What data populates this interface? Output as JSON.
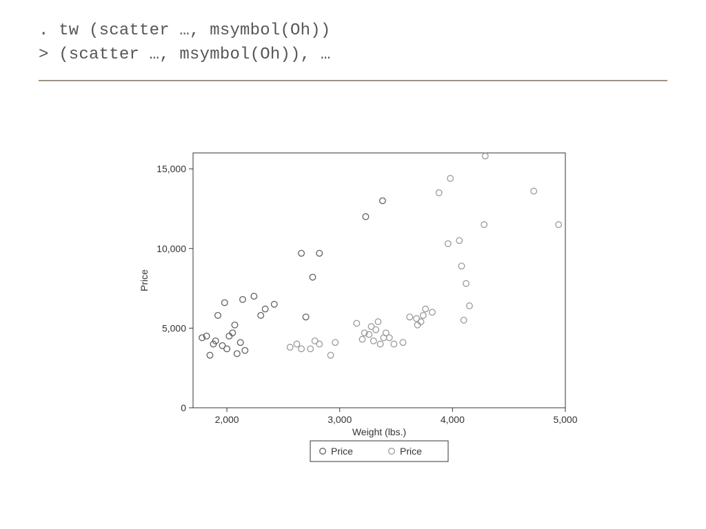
{
  "code": {
    "line1": ". tw (scatter …, msymbol(Oh))",
    "line2": "> (scatter …, msymbol(Oh)), …"
  },
  "chart_data": {
    "type": "scatter",
    "xlabel": "Weight (lbs.)",
    "ylabel": "Price",
    "xlim": [
      1700,
      5000
    ],
    "ylim": [
      0,
      16000
    ],
    "x_ticks": [
      2000,
      3000,
      4000,
      5000
    ],
    "y_ticks": [
      0,
      5000,
      10000,
      15000
    ],
    "x_tick_labels": [
      "2,000",
      "3,000",
      "4,000",
      "5,000"
    ],
    "y_tick_labels": [
      "0",
      "5,000",
      "10,000",
      "15,000"
    ],
    "legend": [
      {
        "label": "Price",
        "color": "#606060"
      },
      {
        "label": "Price",
        "color": "#9a9a9a"
      }
    ],
    "series": [
      {
        "name": "Price",
        "color": "#606060",
        "points": [
          [
            1780,
            4400
          ],
          [
            1820,
            4500
          ],
          [
            1850,
            3300
          ],
          [
            1880,
            4000
          ],
          [
            1900,
            4200
          ],
          [
            1920,
            5800
          ],
          [
            1960,
            3900
          ],
          [
            1980,
            6600
          ],
          [
            2000,
            3700
          ],
          [
            2020,
            4500
          ],
          [
            2050,
            4700
          ],
          [
            2070,
            5200
          ],
          [
            2090,
            3400
          ],
          [
            2120,
            4100
          ],
          [
            2140,
            6800
          ],
          [
            2160,
            3600
          ],
          [
            2240,
            7000
          ],
          [
            2300,
            5800
          ],
          [
            2340,
            6200
          ],
          [
            2420,
            6500
          ],
          [
            2660,
            9700
          ],
          [
            2700,
            5700
          ],
          [
            2760,
            8200
          ],
          [
            2820,
            9700
          ],
          [
            3230,
            12000
          ],
          [
            3380,
            13000
          ]
        ]
      },
      {
        "name": "Price",
        "color": "#9a9a9a",
        "points": [
          [
            2560,
            3800
          ],
          [
            2620,
            4000
          ],
          [
            2660,
            3700
          ],
          [
            2740,
            3700
          ],
          [
            2780,
            4200
          ],
          [
            2820,
            4000
          ],
          [
            2920,
            3300
          ],
          [
            2960,
            4100
          ],
          [
            3150,
            5300
          ],
          [
            3200,
            4300
          ],
          [
            3220,
            4700
          ],
          [
            3260,
            4600
          ],
          [
            3280,
            5100
          ],
          [
            3300,
            4200
          ],
          [
            3320,
            4900
          ],
          [
            3340,
            5400
          ],
          [
            3360,
            4000
          ],
          [
            3390,
            4400
          ],
          [
            3410,
            4700
          ],
          [
            3440,
            4400
          ],
          [
            3480,
            4000
          ],
          [
            3560,
            4100
          ],
          [
            3620,
            5700
          ],
          [
            3680,
            5600
          ],
          [
            3690,
            5200
          ],
          [
            3720,
            5400
          ],
          [
            3740,
            5800
          ],
          [
            3760,
            6200
          ],
          [
            3820,
            6000
          ],
          [
            3880,
            13500
          ],
          [
            3960,
            10300
          ],
          [
            3980,
            14400
          ],
          [
            4060,
            10500
          ],
          [
            4080,
            8900
          ],
          [
            4100,
            5500
          ],
          [
            4120,
            7800
          ],
          [
            4150,
            6400
          ],
          [
            4280,
            11500
          ],
          [
            4290,
            15800
          ],
          [
            4720,
            13600
          ],
          [
            4940,
            11500
          ]
        ]
      }
    ]
  }
}
